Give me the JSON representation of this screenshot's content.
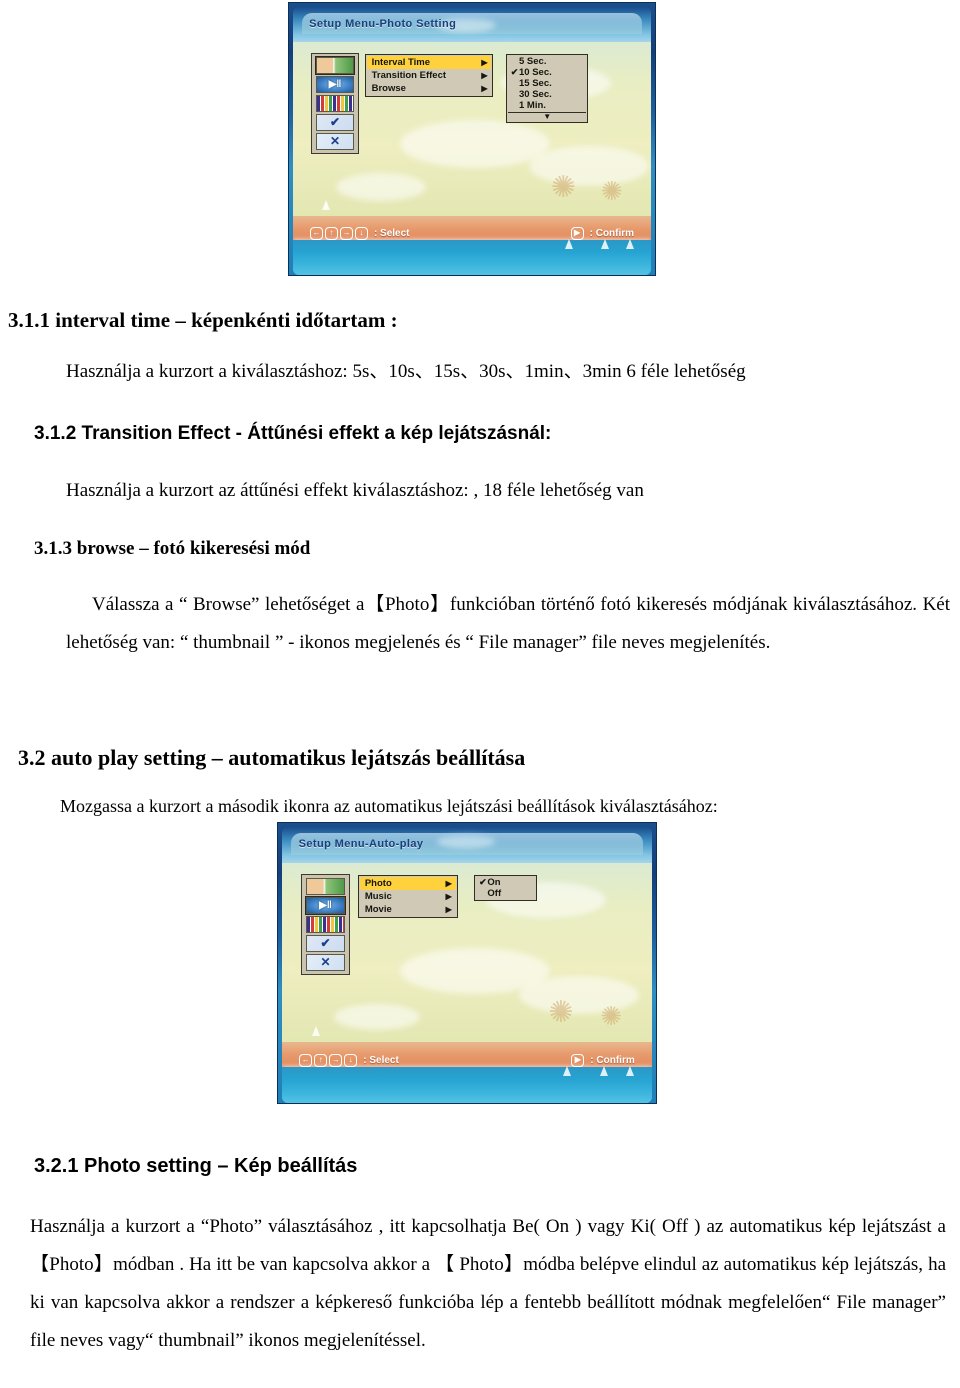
{
  "document": {
    "sections": [
      {
        "id": "s311",
        "heading": "3.1.1 interval time – képenkénti időtartam :",
        "body": "Használja a kurzort a kiválasztáshoz: 5s、10s、15s、30s、1min、3min 6 féle lehetőség"
      },
      {
        "id": "s312",
        "heading": "3.1.2 Transition Effect - Áttűnési effekt a kép lejátszásnál:",
        "body": "Használja a kurzort az áttűnési effekt kiválasztáshoz:   , 18 féle lehetőség van"
      },
      {
        "id": "s313",
        "heading": "3.1.3 browse – fotó kikeresési mód",
        "body": "Válassza a “ Browse” lehetőséget a【Photo】funkcióban történő fotó kikeresés módjának kiválasztásához. Két lehetőség van: “ thumbnail ” - ikonos megjelenés és “ File manager” file neves megjelenítés."
      },
      {
        "id": "s32",
        "heading": "3.2 auto play setting – automatikus lejátszás beállítása",
        "body": "Mozgassa a kurzort a második ikonra az automatikus lejátszási beállítások kiválasztásához:"
      },
      {
        "id": "s321",
        "heading": "3.2.1 Photo setting –  Kép beállítás",
        "body": "Használja a kurzort a “Photo” választásához , itt kapcsolhatja Be( On ) vagy Ki( Off ) az automatikus kép lejátszást a【Photo】módban . Ha itt be van kapcsolva akkor a 【 Photo】módba belépve elindul az automatikus kép lejátszás, ha ki van kapcsolva akkor a rendszer a képkereső funkcióba lép a fentebb beállított módnak megfelelően“ File manager”  file neves vagy“ thumbnail” ikonos megjelenítéssel."
      }
    ]
  },
  "screenshot_photo": {
    "title": "Setup Menu-Photo Setting",
    "rail_icons": [
      {
        "name": "photo-transfer-icon",
        "glyph": ""
      },
      {
        "name": "play-media-icon",
        "glyph": "▶"
      },
      {
        "name": "color-bars-icon",
        "glyph": ""
      },
      {
        "name": "check-hand-icon",
        "glyph": "✔"
      },
      {
        "name": "close-x-icon",
        "glyph": "✕"
      }
    ],
    "selected_rail_index": 0,
    "menu": [
      {
        "label": "Interval Time",
        "arrow": "▶",
        "highlighted": true
      },
      {
        "label": "Transition Effect",
        "arrow": "▶",
        "highlighted": false
      },
      {
        "label": "Browse",
        "arrow": "▶",
        "highlighted": false
      }
    ],
    "options": [
      {
        "label": "5 Sec.",
        "checked": false
      },
      {
        "label": "10 Sec.",
        "checked": true
      },
      {
        "label": "15 Sec.",
        "checked": false
      },
      {
        "label": "30 Sec.",
        "checked": false
      },
      {
        "label": "1 Min.",
        "checked": false
      }
    ],
    "options_scroll_glyph": "▼",
    "hint_keys": [
      "←",
      "↑",
      "→",
      "↓"
    ],
    "hint_select": ": Select",
    "hint_confirm_key": "▶",
    "hint_confirm": ": Confirm"
  },
  "screenshot_autoplay": {
    "title": "Setup Menu-Auto-play",
    "rail_icons": [
      {
        "name": "photo-transfer-icon",
        "glyph": ""
      },
      {
        "name": "play-media-icon",
        "glyph": "▶"
      },
      {
        "name": "color-bars-icon",
        "glyph": ""
      },
      {
        "name": "check-hand-icon",
        "glyph": "✔"
      },
      {
        "name": "close-x-icon",
        "glyph": "✕"
      }
    ],
    "selected_rail_index": 1,
    "menu": [
      {
        "label": "Photo",
        "arrow": "▶",
        "highlighted": true
      },
      {
        "label": "Music",
        "arrow": "▶",
        "highlighted": false
      },
      {
        "label": "Movie",
        "arrow": "▶",
        "highlighted": false
      }
    ],
    "options": [
      {
        "label": "On",
        "checked": true
      },
      {
        "label": "Off",
        "checked": false
      }
    ],
    "hint_keys": [
      "←",
      "↑",
      "→",
      "↓"
    ],
    "hint_select": ": Select",
    "hint_confirm_key": "▶",
    "hint_confirm": ": Confirm"
  },
  "colors": {
    "highlight": "#ffd23d",
    "panel": "#cfc9b6",
    "panel_border": "#2e2e22",
    "tv_border": "#1b4f8c",
    "title_text": "#1a3f7a",
    "hint_bar": "#e79a6c"
  }
}
